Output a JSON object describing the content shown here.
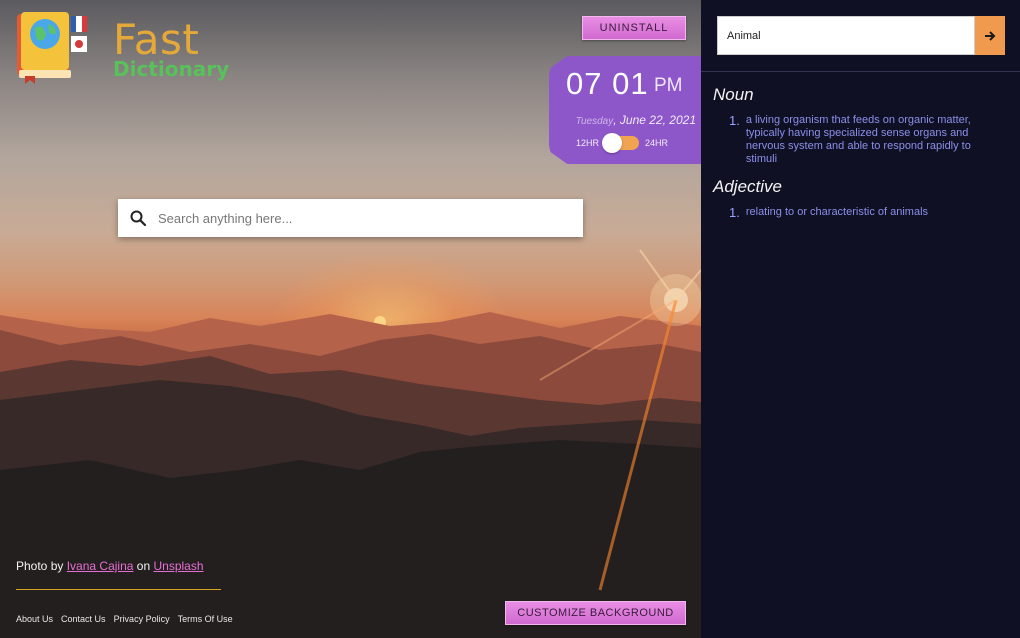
{
  "logo": {
    "word1": "Fast",
    "word2": "Dictionary"
  },
  "uninstall_label": "UNINSTALL",
  "clock": {
    "time": "07 01",
    "ampm": "PM",
    "weekday": "Tuesday",
    "date": "June 22, 2021",
    "left_format": "12HR",
    "right_format": "24HR"
  },
  "search": {
    "placeholder": "Search anything here..."
  },
  "credit": {
    "prefix": "Photo by",
    "author": "Ivana Cajina",
    "on": "on",
    "site": "Unsplash"
  },
  "footer": {
    "links": [
      "About Us",
      "Contact Us",
      "Privacy Policy",
      "Terms Of Use"
    ]
  },
  "customize_label": "CUSTOMIZE BACKGROUND",
  "dictionary": {
    "input_value": "Animal",
    "entries": [
      {
        "pos": "Noun",
        "definitions": [
          "a living organism that feeds on organic matter, typically having specialized sense organs and nervous system and able to respond rapidly to stimuli"
        ]
      },
      {
        "pos": "Adjective",
        "definitions": [
          "relating to or characteristic of animals"
        ]
      }
    ]
  },
  "colors": {
    "accent_pink": "#d06ad0",
    "clock_purple": "#8d57c9",
    "toggle_orange": "#f0a451",
    "definition_blue": "#8c8fe8",
    "panel_bg": "#0f1023"
  },
  "icons": {
    "search": "search-icon",
    "arrow": "arrow-right-icon"
  }
}
